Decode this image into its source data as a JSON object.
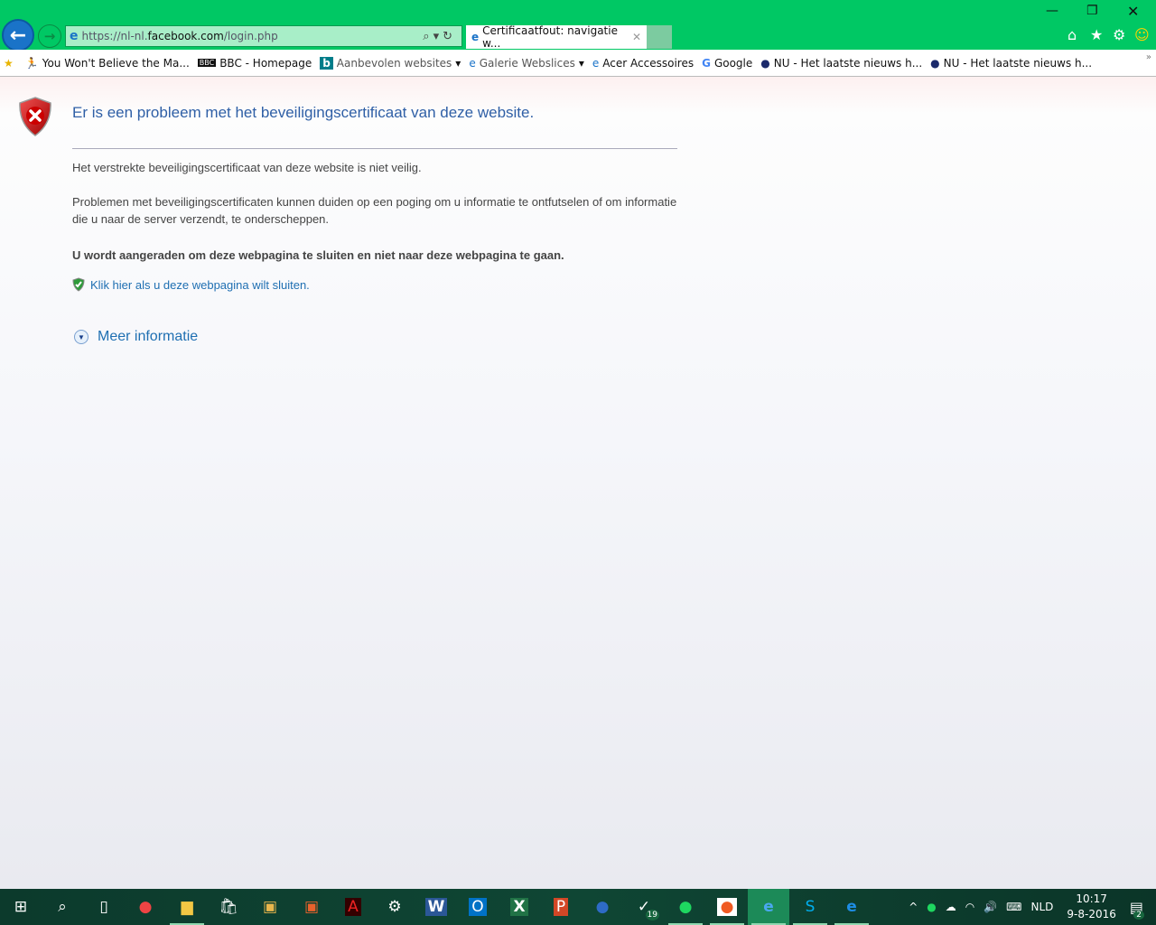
{
  "browser": {
    "address": {
      "prefix": "https://nl-nl.",
      "host": "facebook.com",
      "path": "/login.php"
    },
    "tab_title": "Certificaatfout: navigatie w...",
    "favorites": [
      {
        "label": "You Won't Believe the Ma...",
        "icon": "runner-icon"
      },
      {
        "label": "BBC - Homepage",
        "icon": "bbc-icon"
      },
      {
        "label": "Aanbevolen websites",
        "icon": "bing-icon",
        "dropdown": true
      },
      {
        "label": "Galerie Webslices",
        "icon": "ie-page-icon",
        "dropdown": true
      },
      {
        "label": "Acer Accessoires",
        "icon": "ie-page-icon"
      },
      {
        "label": "Google",
        "icon": "google-icon"
      },
      {
        "label": "NU - Het laatste nieuws h...",
        "icon": "nu-icon"
      },
      {
        "label": "NU - Het laatste nieuws h...",
        "icon": "nu-icon"
      }
    ]
  },
  "page": {
    "title": "Er is een probleem met het beveiligingscertificaat van deze website.",
    "p1": "Het verstrekte beveiligingscertificaat van deze website is niet veilig.",
    "p2": "Problemen met beveiligingscertificaten kunnen duiden op een poging om u informatie te ontfutselen of om informatie die u naar de server verzendt, te onderscheppen.",
    "warning": "U wordt aangeraden om deze webpagina te sluiten en niet naar deze webpagina te gaan.",
    "close_link": "Klik hier als u deze webpagina wilt sluiten.",
    "more_info": "Meer informatie"
  },
  "taskbar": {
    "wunderlist_badge": "19",
    "language": "NLD",
    "time": "10:17",
    "date": "9-8-2016",
    "notifications": "2"
  }
}
